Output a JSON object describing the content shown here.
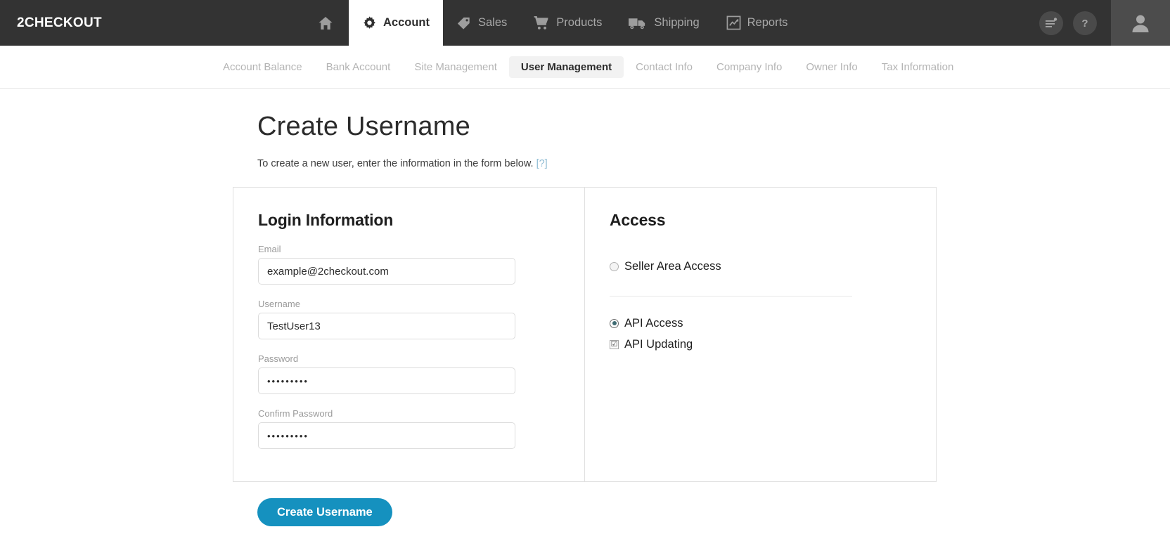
{
  "brand": {
    "name": "2CHECKOUT"
  },
  "topnav": {
    "items": [
      {
        "label": "",
        "icon": "home-icon",
        "active": false
      },
      {
        "label": "Account",
        "icon": "gear-icon",
        "active": true
      },
      {
        "label": "Sales",
        "icon": "tag-icon",
        "active": false
      },
      {
        "label": "Products",
        "icon": "cart-icon",
        "active": false
      },
      {
        "label": "Shipping",
        "icon": "truck-icon",
        "active": false
      },
      {
        "label": "Reports",
        "icon": "chart-icon",
        "active": false
      }
    ],
    "right": {
      "notifications_icon": "list-notification-icon",
      "help_icon": "question-mark-icon",
      "avatar_icon": "user-avatar-icon"
    }
  },
  "subnav": {
    "items": [
      {
        "label": "Account Balance",
        "active": false
      },
      {
        "label": "Bank Account",
        "active": false
      },
      {
        "label": "Site Management",
        "active": false
      },
      {
        "label": "User Management",
        "active": true
      },
      {
        "label": "Contact Info",
        "active": false
      },
      {
        "label": "Company Info",
        "active": false
      },
      {
        "label": "Owner Info",
        "active": false
      },
      {
        "label": "Tax Information",
        "active": false
      }
    ]
  },
  "page": {
    "title": "Create Username",
    "description": "To create a new user, enter the information in the form below.",
    "help_link": "[?]"
  },
  "login_section": {
    "title": "Login Information",
    "fields": [
      {
        "label": "Email",
        "value": "example@2checkout.com",
        "placeholder": ""
      },
      {
        "label": "Username",
        "value": "TestUser13",
        "placeholder": ""
      },
      {
        "label": "Password",
        "value": "•••••••••",
        "placeholder": ""
      },
      {
        "label": "Confirm Password",
        "value": "•••••••••",
        "placeholder": ""
      }
    ]
  },
  "access_section": {
    "title": "Access",
    "seller_area": {
      "label": "Seller Area Access",
      "type": "radio",
      "checked": false
    },
    "api_access": {
      "label": "API Access",
      "type": "radio",
      "checked": true
    },
    "api_updating": {
      "label": "API Updating",
      "type": "checkbox",
      "checked": true,
      "mark": "☑"
    }
  },
  "submit": {
    "label": "Create Username"
  },
  "colors": {
    "nav_bg": "#333333",
    "accent": "#1591bf",
    "link": "#8fbcd4",
    "muted_text": "#b4b4b4"
  }
}
